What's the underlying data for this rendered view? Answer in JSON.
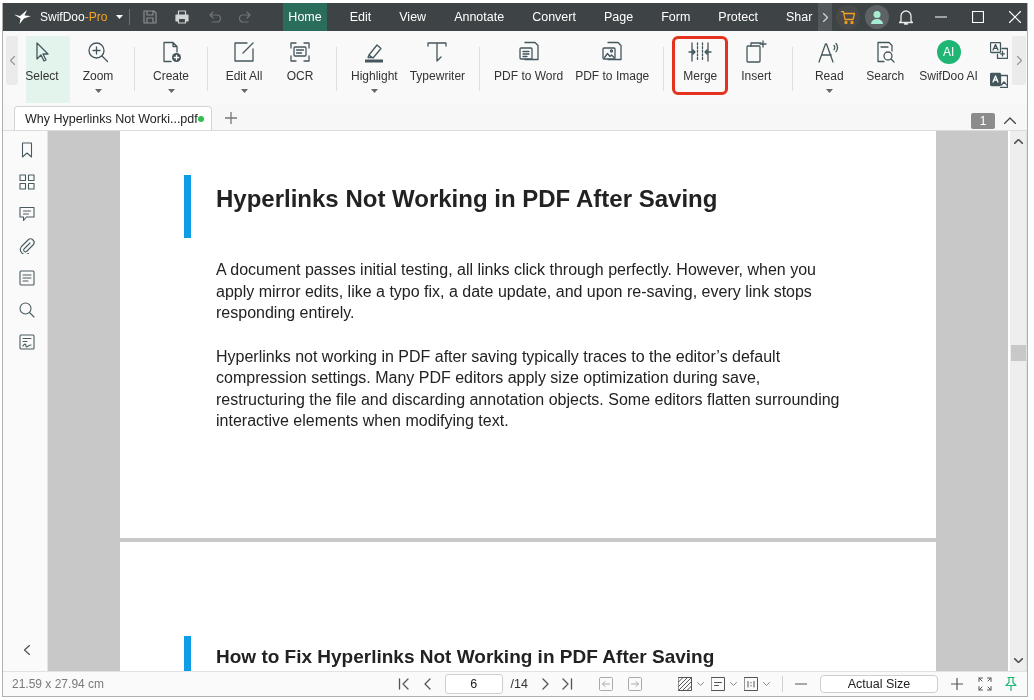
{
  "app": {
    "name": "SwifDoo",
    "edition": "-Pro"
  },
  "menu_tabs": [
    {
      "label": "Home",
      "selected": true
    },
    {
      "label": "Edit",
      "selected": false
    },
    {
      "label": "View",
      "selected": false
    },
    {
      "label": "Annotate",
      "selected": false
    },
    {
      "label": "Convert",
      "selected": false
    },
    {
      "label": "Page",
      "selected": false
    },
    {
      "label": "Form",
      "selected": false
    },
    {
      "label": "Protect",
      "selected": false
    },
    {
      "label": "Shar",
      "selected": false
    }
  ],
  "ribbon": {
    "groups": [
      {
        "items": [
          {
            "label": "Select",
            "selected": true,
            "dropdown": false,
            "outlined": false
          },
          {
            "label": "Zoom",
            "selected": false,
            "dropdown": true,
            "outlined": false
          }
        ]
      },
      {
        "items": [
          {
            "label": "Create",
            "selected": false,
            "dropdown": true,
            "outlined": false
          }
        ]
      },
      {
        "items": [
          {
            "label": "Edit All",
            "selected": false,
            "dropdown": true,
            "outlined": false
          },
          {
            "label": "OCR",
            "selected": false,
            "dropdown": false,
            "outlined": false
          }
        ]
      },
      {
        "items": [
          {
            "label": "Highlight",
            "selected": false,
            "dropdown": true,
            "outlined": false
          },
          {
            "label": "Typewriter",
            "selected": false,
            "dropdown": false,
            "outlined": false
          }
        ]
      },
      {
        "items": [
          {
            "label": "PDF to Word",
            "selected": false,
            "dropdown": false,
            "outlined": false
          },
          {
            "label": "PDF to Image",
            "selected": false,
            "dropdown": false,
            "outlined": false
          }
        ]
      },
      {
        "items": [
          {
            "label": "Merge",
            "selected": false,
            "dropdown": false,
            "outlined": true
          },
          {
            "label": "Insert",
            "selected": false,
            "dropdown": false,
            "outlined": false
          }
        ]
      },
      {
        "items": [
          {
            "label": "Read",
            "selected": false,
            "dropdown": true,
            "outlined": false
          },
          {
            "label": "Search",
            "selected": false,
            "dropdown": false,
            "outlined": false
          },
          {
            "label": "SwifDoo AI",
            "selected": false,
            "dropdown": false,
            "outlined": false,
            "icon_text": "AI"
          }
        ]
      }
    ]
  },
  "document_tabs": [
    {
      "title": "Why Hyperlinks Not Worki...pdf",
      "selected": true,
      "modified": true
    }
  ],
  "page_badge": "1",
  "pages": [
    {
      "heading": "Hyperlinks Not Working in PDF After Saving",
      "paragraphs": [
        "A document passes initial testing, all links click through perfectly. However, when you apply mirror edits, like a typo fix, a date update, and upon re-saving, every link stops responding entirely.",
        "Hyperlinks not working in PDF after saving typically traces to the editor’s default compression settings. Many PDF editors apply size optimization during save, restructuring the file and discarding annotation objects. Some editors flatten surrounding interactive elements when modifying text."
      ]
    },
    {
      "heading": "How to Fix Hyperlinks Not Working in PDF After Saving"
    }
  ],
  "status_bar": {
    "page_size": "21.59 x 27.94 cm",
    "current_page": "6",
    "page_count": "/14",
    "zoom": "Actual Size"
  }
}
